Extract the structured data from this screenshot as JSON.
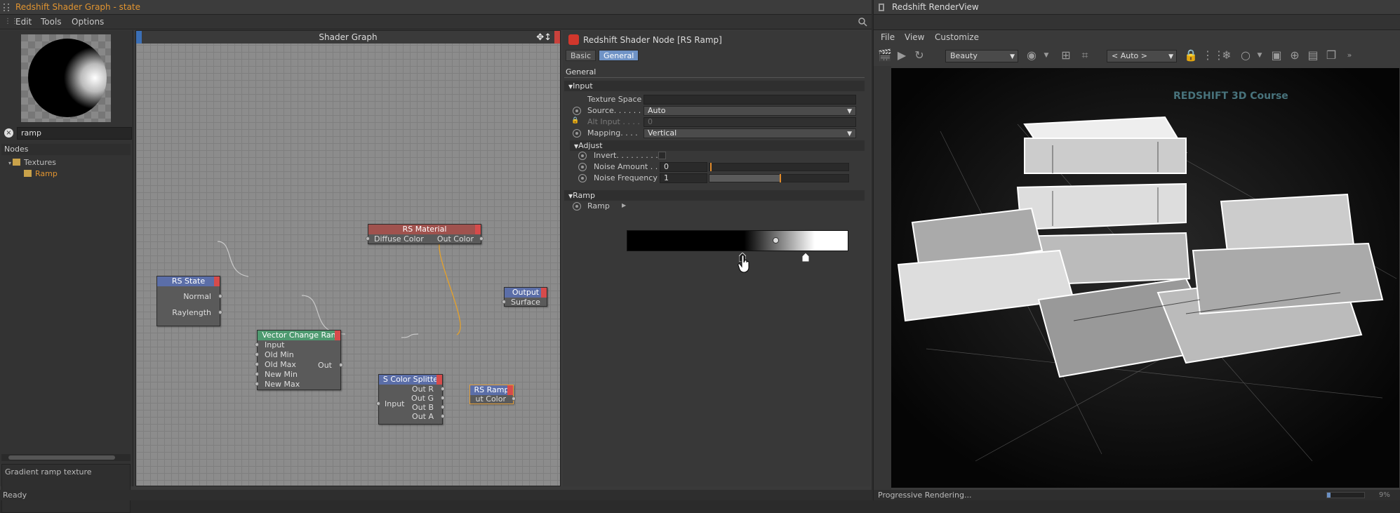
{
  "left_window": {
    "title": "Redshift Shader Graph - state",
    "menu": [
      "Edit",
      "Tools",
      "Options"
    ],
    "search_filter": "ramp",
    "nodes_header": "Nodes",
    "tree": [
      {
        "label": "Textures",
        "selected": false
      },
      {
        "label": "Ramp",
        "selected": true
      }
    ],
    "description": "Gradient ramp texture",
    "status": "Ready"
  },
  "graph": {
    "title": "Shader Graph",
    "nodes": {
      "rs_material": {
        "title": "RS Material",
        "in": "Diffuse Color",
        "out": "Out Color"
      },
      "rs_state": {
        "title": "RS State",
        "out1": "Normal",
        "out2": "Raylength"
      },
      "vector_change": {
        "title": "Vector Change Ran",
        "inputs": [
          "Input",
          "Old Min",
          "Old Max",
          "New Min",
          "New Max"
        ],
        "out": "Out"
      },
      "color_splitter": {
        "title": "S Color Splitte",
        "in": "Input",
        "outs": [
          "Out R",
          "Out G",
          "Out B",
          "Out A"
        ]
      },
      "rs_ramp": {
        "title": "RS Ramp",
        "out": "ut Color"
      },
      "output": {
        "title": "Output",
        "in": "Surface"
      }
    }
  },
  "attributes": {
    "node_title": "Redshift Shader Node [RS Ramp]",
    "tabs": [
      {
        "label": "Basic",
        "active": false
      },
      {
        "label": "General",
        "active": true
      }
    ],
    "general_label": "General",
    "input_section": "Input",
    "texture_space_label": "Texture Space",
    "texture_space_value": "",
    "source_label": "Source. . . . . .",
    "source_value": "Auto",
    "alt_input_label": "Alt Input . . . .",
    "alt_input_value": "0",
    "mapping_label": "Mapping. . . .",
    "mapping_value": "Vertical",
    "adjust_section": "Adjust",
    "invert_label": "Invert. . . . . . . . .",
    "noise_amount_label": "Noise Amount . .",
    "noise_amount_value": "0",
    "noise_frequency_label": "Noise Frequency",
    "noise_frequency_value": "1",
    "ramp_section": "Ramp",
    "ramp_label": "Ramp"
  },
  "render_view": {
    "title": "Redshift RenderView",
    "menu": [
      "File",
      "View",
      "Customize"
    ],
    "aov_select": "Beauty",
    "camera_select": "< Auto >",
    "overlay_text": "REDSHIFT 3D Course",
    "status": "Progressive Rendering...",
    "progress_percent": "9%",
    "progress_fraction": 0.09
  },
  "colors": {
    "accent_orange": "#e19430",
    "selected_tab": "#6f93c6",
    "node_header_material": "#a0524e",
    "node_header_state": "#5b6ea8",
    "node_header_vector": "#4e9a70",
    "node_header_splitter": "#5b6ea8",
    "node_header_ramp": "#5b6ea8"
  }
}
